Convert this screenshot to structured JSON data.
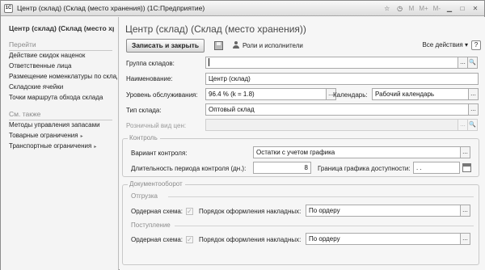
{
  "window": {
    "app_icon": "1C",
    "title": "Центр (склад) (Склад (место хранения))  (1С:Предприятие)",
    "buttons": [
      "M",
      "M+",
      "M-"
    ]
  },
  "sidebar": {
    "form_name": "Центр (склад) (Склад (место хранения))",
    "go_section": "Перейти",
    "go_items": [
      {
        "label": "Действие скидок наценок"
      },
      {
        "label": "Ответственные лица"
      },
      {
        "label": "Размещение номенклатуры по складским ячейкам"
      },
      {
        "label": "Складские ячейки"
      },
      {
        "label": "Точки маршрута обхода склада"
      }
    ],
    "see_also_section": "См. также",
    "see_also_items": [
      {
        "label": "Методы управления запасами"
      },
      {
        "label": "Товарные ограничения"
      },
      {
        "label": "Транспортные ограничения"
      }
    ]
  },
  "form": {
    "title": "Центр (склад) (Склад (место хранения))",
    "toolbar": {
      "save_close": "Записать и закрыть",
      "roles": "Роли и исполнители",
      "all_actions": "Все действия",
      "help": "?"
    },
    "fields": {
      "warehouse_group": {
        "label": "Группа складов:",
        "value": ""
      },
      "name": {
        "label": "Наименование:",
        "value": "Центр (склад)"
      },
      "service_level": {
        "label": "Уровень обслуживания:",
        "value": "96.4 % (k = 1.8)"
      },
      "calendar": {
        "label": "Календарь:",
        "value": "Рабочий календарь"
      },
      "warehouse_type": {
        "label": "Тип склада:",
        "value": "Оптовый склад"
      },
      "retail_price_type": {
        "label": "Розничный вид цен:",
        "value": ""
      }
    },
    "control": {
      "title": "Контроль",
      "variant_label": "Вариант контроля:",
      "variant_value": "Остатки с учетом графика",
      "period_label": "Длительность периода контроля (дн.):",
      "period_value": "8",
      "border_label": "Граница графика доступности:",
      "border_value": ". ."
    },
    "docflow": {
      "title": "Документооборот",
      "shipment": {
        "title": "Отгрузка",
        "order_scheme_label": "Ордерная схема:",
        "invoice_label": "Порядок оформления накладных:",
        "invoice_value": "По ордеру"
      },
      "receipt": {
        "title": "Поступление",
        "order_scheme_label": "Ордерная схема:",
        "invoice_label": "Порядок оформления накладных:",
        "invoice_value": "По ордеру"
      }
    }
  }
}
